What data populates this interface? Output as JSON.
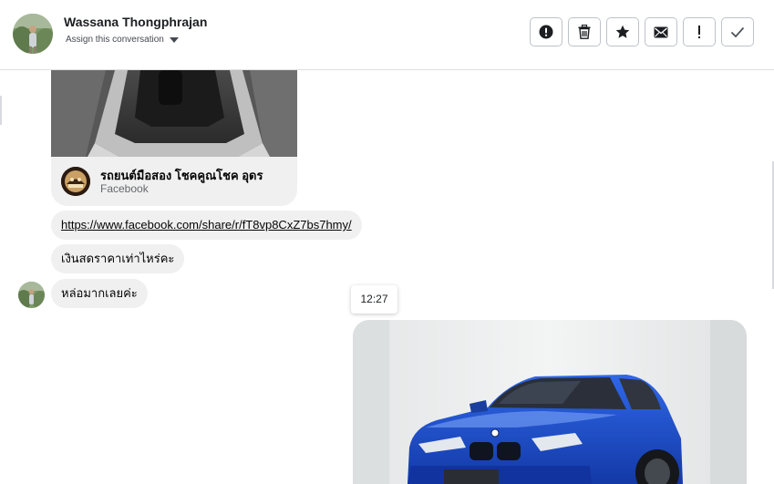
{
  "header": {
    "contact_name": "Wassana Thongphrajan",
    "assign_label": "Assign this conversation",
    "actions": [
      {
        "name": "alert-circle-button",
        "icon": "alert-circle-icon"
      },
      {
        "name": "delete-button",
        "icon": "trash-icon"
      },
      {
        "name": "star-button",
        "icon": "star-icon"
      },
      {
        "name": "mail-button",
        "icon": "mail-icon"
      },
      {
        "name": "exclamation-button",
        "icon": "exclamation-icon"
      },
      {
        "name": "done-button",
        "icon": "check-icon"
      }
    ]
  },
  "messages": {
    "shared_post": {
      "page_name": "รถยนต์มือสอง โชคคูณโชค อุดร",
      "source": "Facebook"
    },
    "link_text": "https://www.facebook.com/share/r/fT8vp8CxZ7bs7hmy/",
    "text_1": "เงินสดราคาเท่าไหร่คะ",
    "text_2": "หล่อมากเลยค่ะ",
    "timestamp": "12:27"
  },
  "colors": {
    "bubble": "#f0f0f0",
    "border": "#dddfe2",
    "car_blue": "#1f4fc4"
  }
}
